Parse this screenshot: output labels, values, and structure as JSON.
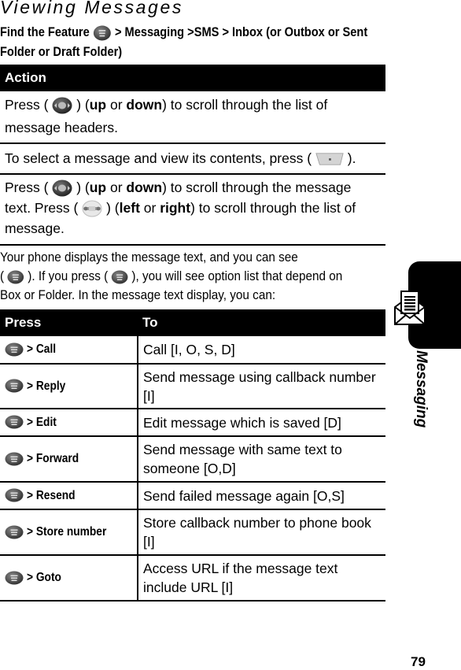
{
  "title": "Viewing Messages",
  "find_feature": {
    "prefix": "Find the Feature",
    "icon": "menu-key-icon",
    "path_line1": "> Messaging >SMS > Inbox (or Outbox or Sent",
    "path_line2": "Folder or Draft Folder)"
  },
  "action_table": {
    "header": "Action",
    "rows": [
      {
        "parts": [
          "Press (",
          "nav-key-icon",
          ") (",
          "up",
          " or ",
          "down",
          ") to scroll through the list of",
          "message headers."
        ]
      },
      {
        "text_before": "To select a message and view its contents, press (",
        "icon": "select-softkey-icon",
        "text_after": ")."
      },
      {
        "parts": [
          "Press (",
          "nav-key-icon",
          ") (",
          "up",
          " or ",
          "down",
          ") to scroll through the message",
          "text. Press (",
          "nav-left-right-icon",
          ") (",
          "left",
          " or ",
          "right",
          ") to scroll through the list of",
          "message."
        ]
      }
    ]
  },
  "paragraph": {
    "line1": "Your phone displays the message text, and you can see",
    "line2_a": "(",
    "line2_b": "). If you press (",
    "line2_c": "), you will see option list that depend on",
    "line3": "Box or Folder. In the message text display, you can:"
  },
  "press_table": {
    "headers": [
      "Press",
      "To"
    ],
    "rows": [
      {
        "press": "> Call",
        "to": "Call [I, O, S, D]"
      },
      {
        "press": "> Reply",
        "to": "Send message using callback number [I]"
      },
      {
        "press": "> Edit",
        "to": "Edit message which is saved [D]"
      },
      {
        "press": "> Forward",
        "to": "Send message with same text to someone [O,D]"
      },
      {
        "press": "> Resend",
        "to": "Send failed message again [O,S]"
      },
      {
        "press": "> Store number",
        "to": "Store callback number to phone book [I]"
      },
      {
        "press": "> Goto",
        "to": "Access URL if the message text include URL [I]"
      }
    ]
  },
  "side_tab": {
    "label": "Messaging",
    "icon": "envelope-icon"
  },
  "page_number": "79"
}
